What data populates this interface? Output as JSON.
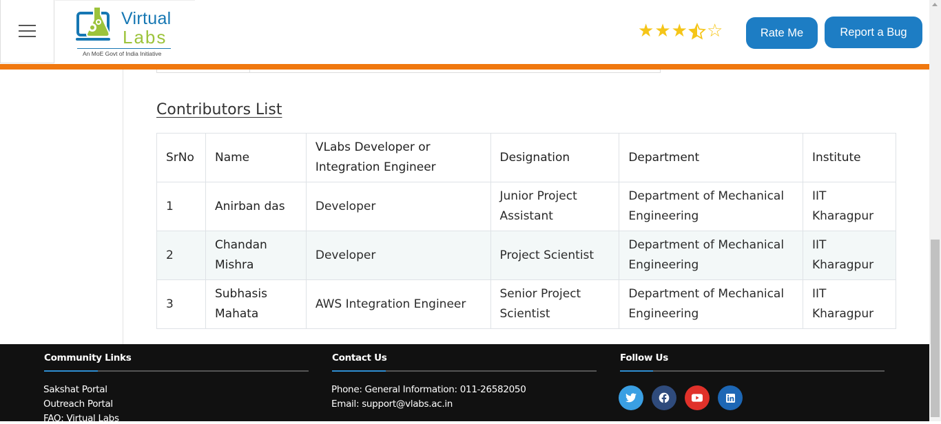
{
  "header": {
    "logo": {
      "name_line1": "Virtual",
      "name_line2": "Labs",
      "tagline": "An MoE Govt of India Initiative"
    },
    "rating": {
      "value": 3.5,
      "max": 5
    },
    "rate_button": "Rate Me",
    "bug_button": "Report a Bug"
  },
  "contributors": {
    "title": "Contributors List",
    "columns": [
      "SrNo",
      "Name",
      "VLabs Developer or Integration Engineer",
      "Designation",
      "Department",
      "Institute"
    ],
    "rows": [
      {
        "srno": "1",
        "name": "Anirban das",
        "role": "Developer",
        "designation": "Junior Project Assistant",
        "department": "Department of Mechanical Engineering",
        "institute": "IIT Kharagpur"
      },
      {
        "srno": "2",
        "name": "Chandan Mishra",
        "role": "Developer",
        "designation": "Project Scientist",
        "department": "Department of Mechanical Engineering",
        "institute": "IIT Kharagpur"
      },
      {
        "srno": "3",
        "name": "Subhasis Mahata",
        "role": "AWS Integration Engineer",
        "designation": "Senior Project Scientist",
        "department": "Department of Mechanical Engineering",
        "institute": "IIT Kharagpur"
      }
    ]
  },
  "footer": {
    "community": {
      "title": "Community Links",
      "links": [
        "Sakshat Portal",
        "Outreach Portal",
        "FAQ: Virtual Labs"
      ]
    },
    "contact": {
      "title": "Contact Us",
      "phone": "Phone: General Information: 011-26582050",
      "email": "Email: support@vlabs.ac.in"
    },
    "follow": {
      "title": "Follow Us",
      "icons": [
        "twitter-icon",
        "facebook-icon",
        "youtube-icon",
        "linkedin-icon"
      ]
    }
  },
  "colors": {
    "accent": "#1d7dc4",
    "orange_bar": "#f0780f",
    "footer_bg": "#111111",
    "star": "#f5c518"
  }
}
